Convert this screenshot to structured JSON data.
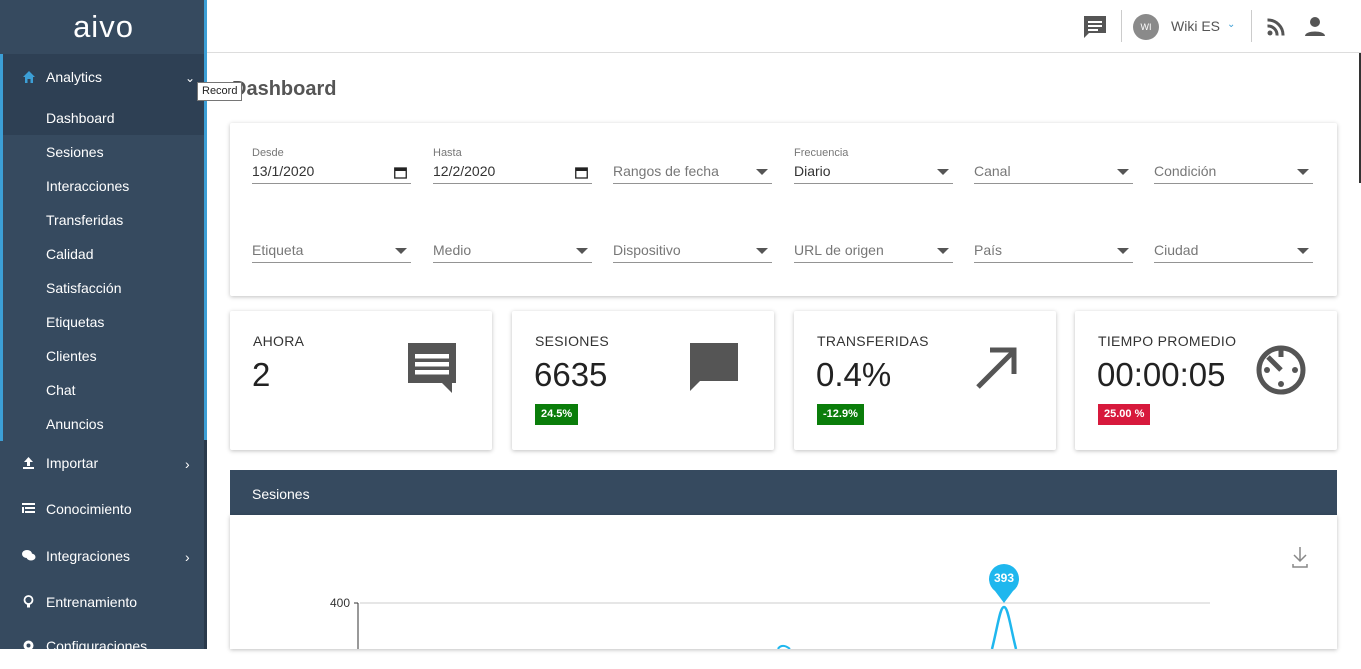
{
  "app": {
    "logo": "aivo"
  },
  "sidebar": {
    "analytics": {
      "label": "Analytics",
      "icon": "home-icon",
      "chevron": "⌄"
    },
    "sub_items": [
      "Dashboard",
      "Sesiones",
      "Interacciones",
      "Transferidas",
      "Calidad",
      "Satisfacción",
      "Etiquetas",
      "Clientes",
      "Chat",
      "Anuncios"
    ],
    "nav_items": [
      {
        "label": "Importar",
        "icon": "upload-icon",
        "chevron": "›"
      },
      {
        "label": "Conocimiento",
        "icon": "list-icon",
        "chevron": ""
      },
      {
        "label": "Integraciones",
        "icon": "chat-bubbles-icon",
        "chevron": "›"
      },
      {
        "label": "Entrenamiento",
        "icon": "bulb-icon",
        "chevron": ""
      },
      {
        "label": "Configuraciones",
        "icon": "gear-icon",
        "chevron": ""
      }
    ],
    "tooltip": "Record"
  },
  "topbar": {
    "avatar": "WI",
    "user": "Wiki ES",
    "user_chev": "⌄"
  },
  "page": {
    "title": "Dashboard"
  },
  "filters": {
    "row1": [
      {
        "label": "Desde",
        "value": "13/1/2020",
        "kind": "date"
      },
      {
        "label": "Hasta",
        "value": "12/2/2020",
        "kind": "date"
      },
      {
        "label": "",
        "placeholder": "Rangos de fecha",
        "kind": "select"
      },
      {
        "label": "Frecuencia",
        "value": "Diario",
        "kind": "select"
      },
      {
        "label": "",
        "placeholder": "Canal",
        "kind": "select"
      },
      {
        "label": "",
        "placeholder": "Condición",
        "kind": "select"
      }
    ],
    "row2": [
      {
        "placeholder": "Etiqueta"
      },
      {
        "placeholder": "Medio"
      },
      {
        "placeholder": "Dispositivo"
      },
      {
        "placeholder": "URL de origen"
      },
      {
        "placeholder": "País"
      },
      {
        "placeholder": "Ciudad"
      }
    ]
  },
  "stats": [
    {
      "title": "AHORA",
      "value": "2",
      "badge": "",
      "icon": "message-lines-icon"
    },
    {
      "title": "SESIONES",
      "value": "6635",
      "badge": "24.5%",
      "badge_color": "#0a7d0a",
      "icon": "chat-bubble-icon"
    },
    {
      "title": "TRANSFERIDAS",
      "value": "0.4%",
      "badge": "-12.9%",
      "badge_color": "#0a7d0a",
      "icon": "arrow-up-right-icon"
    },
    {
      "title": "TIEMPO PROMEDIO",
      "value": "00:00:05",
      "badge": "25.00 %",
      "badge_color": "#d7193c",
      "icon": "timer-icon"
    }
  ],
  "chart_panel": {
    "title": "Sesiones",
    "download_icon": "download-icon"
  },
  "chart_data": {
    "type": "line",
    "title": "",
    "y_ticks": [
      400
    ],
    "annotations": [
      {
        "label": "393",
        "value": 393
      }
    ],
    "series_color": "#1fb7ee"
  }
}
